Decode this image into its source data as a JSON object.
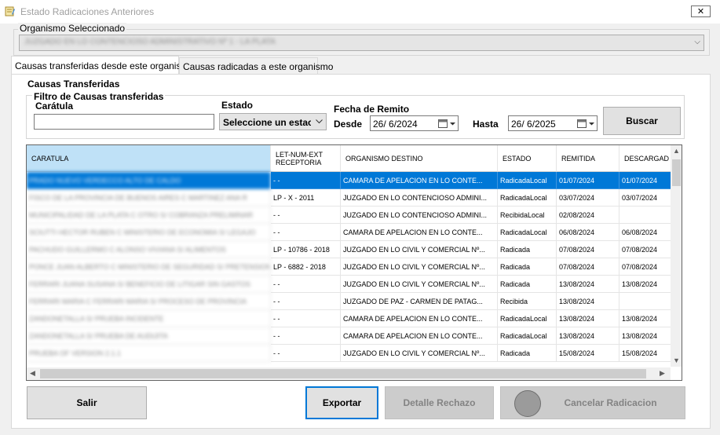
{
  "window": {
    "title": "Estado Radicaciones Anteriores",
    "close_label": "✕",
    "icon": "notepad-icon"
  },
  "organismo": {
    "label": "Organismo Seleccionado",
    "value": "JUZGADO EN LO CONTENCIOSO ADMINISTRATIVO Nº 1 - LA PLATA",
    "dropdown_icon": "chevron-down-icon"
  },
  "tabs": [
    {
      "label": "Causas transferidas desde este organismo",
      "active": true
    },
    {
      "label": "Causas radicadas a este organismo",
      "active": false
    }
  ],
  "panel": {
    "section_title": "Causas Transferidas",
    "filter_title": "Filtro de Causas transferidas",
    "caratula_label": "Carátula",
    "caratula_value": "",
    "estado_label": "Estado",
    "estado_value": "Seleccione un estac",
    "fecha_label": "Fecha de Remito",
    "desde_label": "Desde",
    "desde_value": "26/ 6/2024",
    "hasta_label": "Hasta",
    "hasta_value": "26/ 6/2025",
    "buscar_label": "Buscar"
  },
  "grid": {
    "columns": [
      "CARATULA",
      "LET-NUM-EXT RECEPTORIA",
      "ORGANISMO DESTINO",
      "ESTADO",
      "REMITIDA",
      "DESCARGAD"
    ],
    "rows": [
      {
        "caratula": "PRADO NUEVO VERDECCO ALTO DE CALDO",
        "let": "- -",
        "organismo": "CAMARA DE APELACION EN LO CONTE...",
        "estado": "RadicadaLocal",
        "remitida": "01/07/2024",
        "descargada": "01/07/2024",
        "selected": true
      },
      {
        "caratula": "FISCO DE LA PROVINCIA DE BUENOS AIRES C MARTINEZ ANA R",
        "let": "LP - X - 2011",
        "organismo": "JUZGADO EN LO CONTENCIOSO ADMINI...",
        "estado": "RadicadaLocal",
        "remitida": "03/07/2024",
        "descargada": "03/07/2024",
        "selected": false
      },
      {
        "caratula": "MUNICIPALIDAD DE LA PLATA C OTRO S/ COBRANZA PRELIMINAR",
        "let": "- -",
        "organismo": "JUZGADO EN LO CONTENCIOSO ADMINI...",
        "estado": "RecibidaLocal",
        "remitida": "02/08/2024",
        "descargada": "",
        "selected": false
      },
      {
        "caratula": "SCIUTTI HECTOR RUBEN C MINISTERIO DE ECONOMIA S/ LEGAJO",
        "let": "- -",
        "organismo": "CAMARA DE APELACION EN LO CONTE...",
        "estado": "RadicadaLocal",
        "remitida": "06/08/2024",
        "descargada": "06/08/2024",
        "selected": false
      },
      {
        "caratula": "PACHUDO GUILLERMO C ALONSO VIVIANA S/ ALIMENTOS",
        "let": "LP - 10786 - 2018",
        "organismo": "JUZGADO EN LO CIVIL Y COMERCIAL Nº...",
        "estado": "Radicada",
        "remitida": "07/08/2024",
        "descargada": "07/08/2024",
        "selected": false
      },
      {
        "caratula": "PONCE JUAN ALBERTO C MINISTERIO DE SEGURIDAD S/ PRETENSION",
        "let": "LP - 6882 - 2018",
        "organismo": "JUZGADO EN LO CIVIL Y COMERCIAL Nº...",
        "estado": "Radicada",
        "remitida": "07/08/2024",
        "descargada": "07/08/2024",
        "selected": false
      },
      {
        "caratula": "FERRARI JUANA SUSANA S/ BENEFICIO DE LITIGAR SIN GASTOS",
        "let": "- -",
        "organismo": "JUZGADO EN LO CIVIL Y COMERCIAL Nº...",
        "estado": "Radicada",
        "remitida": "13/08/2024",
        "descargada": "13/08/2024",
        "selected": false
      },
      {
        "caratula": "FERRARI MARIA C FERRARI MARIA S/ PROCESO DE PROVINCIA",
        "let": "- -",
        "organismo": "JUZGADO DE PAZ - CARMEN DE PATAG...",
        "estado": "Recibida",
        "remitida": "13/08/2024",
        "descargada": "",
        "selected": false
      },
      {
        "caratula": "ZANDONETALLA S/ PRUEBA INCIDENTE",
        "let": "- -",
        "organismo": "CAMARA DE APELACION EN LO CONTE...",
        "estado": "RadicadaLocal",
        "remitida": "13/08/2024",
        "descargada": "13/08/2024",
        "selected": false
      },
      {
        "caratula": "ZANDONETALLA S/ PRUEBA DE AUDIJITA",
        "let": "- -",
        "organismo": "CAMARA DE APELACION EN LO CONTE...",
        "estado": "RadicadaLocal",
        "remitida": "13/08/2024",
        "descargada": "13/08/2024",
        "selected": false
      },
      {
        "caratula": "PRUEBA OF VERSION 2.1.1",
        "let": "- -",
        "organismo": "JUZGADO EN LO CIVIL Y COMERCIAL Nº...",
        "estado": "Radicada",
        "remitida": "15/08/2024",
        "descargada": "15/08/2024",
        "selected": false
      }
    ]
  },
  "buttons": {
    "salir": "Salir",
    "exportar": "Exportar",
    "detalle_rechazo": "Detalle Rechazo",
    "cancelar_radicacion": "Cancelar Radicacion"
  },
  "icons": {
    "calendar": "calendar-icon",
    "status_indicator": "status-circle-icon"
  },
  "colors": {
    "selection": "#0078d7",
    "header_selected": "#bfe1f7",
    "focus_border": "#0078d7"
  }
}
